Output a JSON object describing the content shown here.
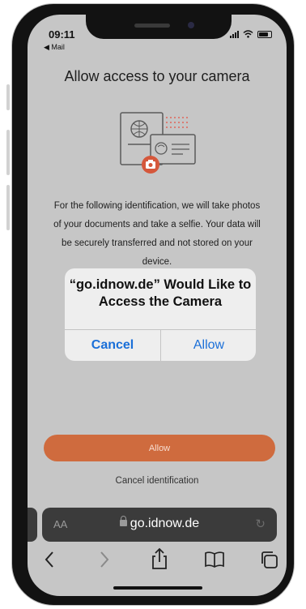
{
  "status_bar": {
    "time": "09:11",
    "back_app": "◀ Mail"
  },
  "page": {
    "title": "Allow access to your camera",
    "description": "For the following identification, we will take photos of your documents and take a selfie. Your data will be securely transferred and not stored on your device.",
    "allow_label": "Allow",
    "cancel_label": "Cancel identification"
  },
  "dialog": {
    "title": "“go.idnow.de” Would Like to Access the Camera",
    "cancel_label": "Cancel",
    "allow_label": "Allow"
  },
  "browser": {
    "aa_label": "AA",
    "url": "go.idnow.de",
    "toolbar": [
      "back-icon",
      "forward-icon",
      "share-icon",
      "bookmarks-icon",
      "tabs-icon"
    ]
  },
  "colors": {
    "accent": "#cf6b3e",
    "ios_blue": "#1a6fd8"
  }
}
